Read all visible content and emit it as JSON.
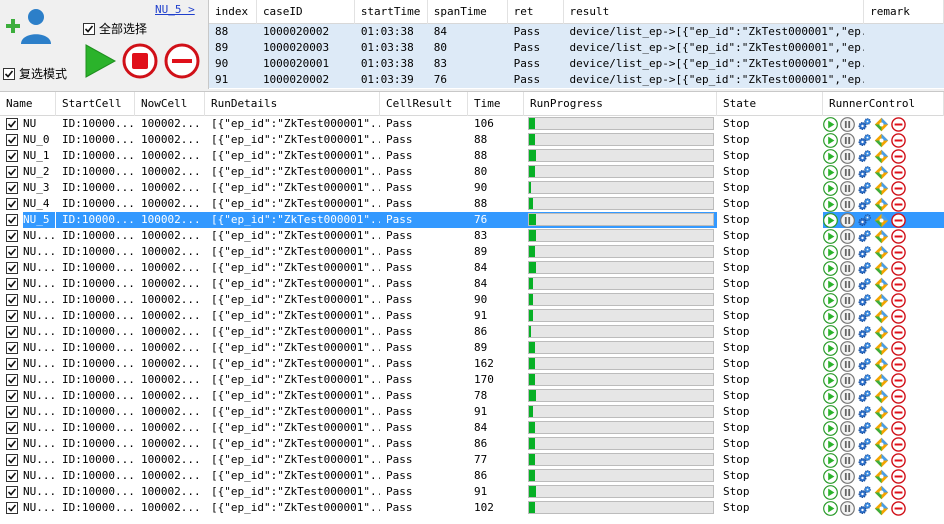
{
  "controls": {
    "select_all_label": "全部选择",
    "multi_mode_label": "复选模式",
    "nu_link": "NU_5 >",
    "select_all_checked": true,
    "multi_mode_checked": true
  },
  "log_table": {
    "columns": [
      "index",
      "caseID",
      "startTime",
      "spanTime",
      "ret",
      "result",
      "remark"
    ],
    "rows": [
      {
        "index": "88",
        "caseID": "1000020002",
        "startTime": "01:03:38",
        "spanTime": "84",
        "ret": "Pass",
        "result": "device/list_ep->[{\"ep_id\":\"ZkTest000001\",\"ep...",
        "remark": ""
      },
      {
        "index": "89",
        "caseID": "1000020003",
        "startTime": "01:03:38",
        "spanTime": "80",
        "ret": "Pass",
        "result": "device/list_ep->[{\"ep_id\":\"ZkTest000001\",\"ep...",
        "remark": ""
      },
      {
        "index": "90",
        "caseID": "1000020001",
        "startTime": "01:03:38",
        "spanTime": "83",
        "ret": "Pass",
        "result": "device/list_ep->[{\"ep_id\":\"ZkTest000001\",\"ep...",
        "remark": ""
      },
      {
        "index": "91",
        "caseID": "1000020002",
        "startTime": "01:03:39",
        "spanTime": "76",
        "ret": "Pass",
        "result": "device/list_ep->[{\"ep_id\":\"ZkTest000001\",\"ep...",
        "remark": ""
      }
    ]
  },
  "grid": {
    "columns": [
      "Name",
      "StartCell",
      "NowCell",
      "RunDetails",
      "CellResult",
      "Time",
      "RunProgress",
      "State",
      "RunnerControl"
    ],
    "selected_index": 6,
    "rows": [
      {
        "name": "NU",
        "start_cell": "ID:10000...",
        "now_cell": "100002...",
        "run_details": "[{\"ep_id\":\"ZkTest000001\"...",
        "cell_result": "Pass",
        "time": "106",
        "progress": 0.03,
        "state": "Stop"
      },
      {
        "name": "NU_0",
        "start_cell": "ID:10000...",
        "now_cell": "100002...",
        "run_details": "[{\"ep_id\":\"ZkTest000001\"...",
        "cell_result": "Pass",
        "time": "88",
        "progress": 0.03,
        "state": "Stop"
      },
      {
        "name": "NU_1",
        "start_cell": "ID:10000...",
        "now_cell": "100002...",
        "run_details": "[{\"ep_id\":\"ZkTest000001\"...",
        "cell_result": "Pass",
        "time": "88",
        "progress": 0.04,
        "state": "Stop"
      },
      {
        "name": "NU_2",
        "start_cell": "ID:10000...",
        "now_cell": "100002...",
        "run_details": "[{\"ep_id\":\"ZkTest000001\"...",
        "cell_result": "Pass",
        "time": "80",
        "progress": 0.03,
        "state": "Stop"
      },
      {
        "name": "NU_3",
        "start_cell": "ID:10000...",
        "now_cell": "100002...",
        "run_details": "[{\"ep_id\":\"ZkTest000001\"...",
        "cell_result": "Pass",
        "time": "90",
        "progress": 0.01,
        "state": "Stop"
      },
      {
        "name": "NU_4",
        "start_cell": "ID:10000...",
        "now_cell": "100002...",
        "run_details": "[{\"ep_id\":\"ZkTest000001\"...",
        "cell_result": "Pass",
        "time": "88",
        "progress": 0.02,
        "state": "Stop"
      },
      {
        "name": "NU_5",
        "start_cell": "ID:10000...",
        "now_cell": "100002...",
        "run_details": "[{\"ep_id\":\"ZkTest000001\"...",
        "cell_result": "Pass",
        "time": "76",
        "progress": 0.04,
        "state": "Stop"
      },
      {
        "name": "NU...",
        "start_cell": "ID:10000...",
        "now_cell": "100002...",
        "run_details": "[{\"ep_id\":\"ZkTest000001\"...",
        "cell_result": "Pass",
        "time": "83",
        "progress": 0.04,
        "state": "Stop"
      },
      {
        "name": "NU...",
        "start_cell": "ID:10000...",
        "now_cell": "100002...",
        "run_details": "[{\"ep_id\":\"ZkTest000001\"...",
        "cell_result": "Pass",
        "time": "89",
        "progress": 0.03,
        "state": "Stop"
      },
      {
        "name": "NU...",
        "start_cell": "ID:10000...",
        "now_cell": "100002...",
        "run_details": "[{\"ep_id\":\"ZkTest000001\"...",
        "cell_result": "Pass",
        "time": "84",
        "progress": 0.04,
        "state": "Stop"
      },
      {
        "name": "NU...",
        "start_cell": "ID:10000...",
        "now_cell": "100002...",
        "run_details": "[{\"ep_id\":\"ZkTest000001\"...",
        "cell_result": "Pass",
        "time": "84",
        "progress": 0.02,
        "state": "Stop"
      },
      {
        "name": "NU...",
        "start_cell": "ID:10000...",
        "now_cell": "100002...",
        "run_details": "[{\"ep_id\":\"ZkTest000001\"...",
        "cell_result": "Pass",
        "time": "90",
        "progress": 0.02,
        "state": "Stop"
      },
      {
        "name": "NU...",
        "start_cell": "ID:10000...",
        "now_cell": "100002...",
        "run_details": "[{\"ep_id\":\"ZkTest000001\"...",
        "cell_result": "Pass",
        "time": "91",
        "progress": 0.02,
        "state": "Stop"
      },
      {
        "name": "NU...",
        "start_cell": "ID:10000...",
        "now_cell": "100002...",
        "run_details": "[{\"ep_id\":\"ZkTest000001\"...",
        "cell_result": "Pass",
        "time": "86",
        "progress": 0.01,
        "state": "Stop"
      },
      {
        "name": "NU...",
        "start_cell": "ID:10000...",
        "now_cell": "100002...",
        "run_details": "[{\"ep_id\":\"ZkTest000001\"...",
        "cell_result": "Pass",
        "time": "89",
        "progress": 0.03,
        "state": "Stop"
      },
      {
        "name": "NU...",
        "start_cell": "ID:10000...",
        "now_cell": "100002...",
        "run_details": "[{\"ep_id\":\"ZkTest000001\"...",
        "cell_result": "Pass",
        "time": "162",
        "progress": 0.03,
        "state": "Stop"
      },
      {
        "name": "NU...",
        "start_cell": "ID:10000...",
        "now_cell": "100002...",
        "run_details": "[{\"ep_id\":\"ZkTest000001\"...",
        "cell_result": "Pass",
        "time": "170",
        "progress": 0.03,
        "state": "Stop"
      },
      {
        "name": "NU...",
        "start_cell": "ID:10000...",
        "now_cell": "100002...",
        "run_details": "[{\"ep_id\":\"ZkTest000001\"...",
        "cell_result": "Pass",
        "time": "78",
        "progress": 0.04,
        "state": "Stop"
      },
      {
        "name": "NU...",
        "start_cell": "ID:10000...",
        "now_cell": "100002...",
        "run_details": "[{\"ep_id\":\"ZkTest000001\"...",
        "cell_result": "Pass",
        "time": "91",
        "progress": 0.02,
        "state": "Stop"
      },
      {
        "name": "NU...",
        "start_cell": "ID:10000...",
        "now_cell": "100002...",
        "run_details": "[{\"ep_id\":\"ZkTest000001\"...",
        "cell_result": "Pass",
        "time": "84",
        "progress": 0.03,
        "state": "Stop"
      },
      {
        "name": "NU...",
        "start_cell": "ID:10000...",
        "now_cell": "100002...",
        "run_details": "[{\"ep_id\":\"ZkTest000001\"...",
        "cell_result": "Pass",
        "time": "86",
        "progress": 0.03,
        "state": "Stop"
      },
      {
        "name": "NU...",
        "start_cell": "ID:10000...",
        "now_cell": "100002...",
        "run_details": "[{\"ep_id\":\"ZkTest000001\"...",
        "cell_result": "Pass",
        "time": "77",
        "progress": 0.03,
        "state": "Stop"
      },
      {
        "name": "NU...",
        "start_cell": "ID:10000...",
        "now_cell": "100002...",
        "run_details": "[{\"ep_id\":\"ZkTest000001\"...",
        "cell_result": "Pass",
        "time": "86",
        "progress": 0.03,
        "state": "Stop"
      },
      {
        "name": "NU...",
        "start_cell": "ID:10000...",
        "now_cell": "100002...",
        "run_details": "[{\"ep_id\":\"ZkTest000001\"...",
        "cell_result": "Pass",
        "time": "91",
        "progress": 0.04,
        "state": "Stop"
      },
      {
        "name": "NU...",
        "start_cell": "ID:10000...",
        "now_cell": "100002...",
        "run_details": "[{\"ep_id\":\"ZkTest000001\"...",
        "cell_result": "Pass",
        "time": "102",
        "progress": 0.03,
        "state": "Stop"
      }
    ]
  },
  "runner_control_icons": [
    "play-icon",
    "pause-icon",
    "settings-gears-icon",
    "web-globe-icon",
    "remove-icon"
  ],
  "colors": {
    "selection": "#3399ff",
    "progress": "#06b025",
    "log_row": "#ddeaf7",
    "play": "#2bb32b",
    "stop": "#e0101a",
    "link": "#1f3fcc"
  }
}
